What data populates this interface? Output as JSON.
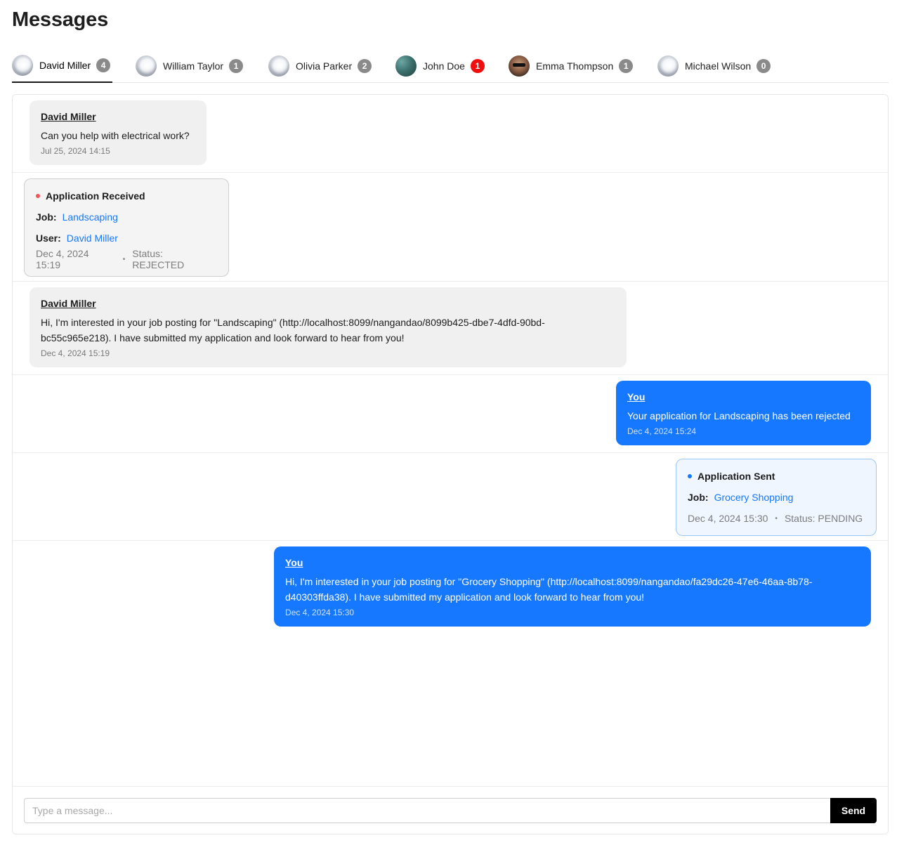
{
  "page": {
    "title": "Messages"
  },
  "tabs": [
    {
      "name": "David Miller",
      "badge": "4",
      "avatar": "default-avatar",
      "active": true
    },
    {
      "name": "William Taylor",
      "badge": "1",
      "avatar": "default-avatar"
    },
    {
      "name": "Olivia Parker",
      "badge": "2",
      "avatar": "default-avatar"
    },
    {
      "name": "John Doe",
      "badge": "1",
      "avatar": "marble-avatar",
      "badge_color": "#f00f0f"
    },
    {
      "name": "Emma Thompson",
      "badge": "1",
      "avatar": "photo-avatar"
    },
    {
      "name": "Michael Wilson",
      "badge": "0",
      "avatar": "default-avatar"
    }
  ],
  "messages": [
    {
      "sender": "David Miller",
      "text": "Can you help with electrical work?",
      "time": "Jul 25, 2024 14:15"
    },
    {
      "card": {
        "title": "Application Received",
        "job_label": "Job:",
        "job": "Landscaping",
        "user_label": "User:",
        "user": "David Miller",
        "time": "Dec 4, 2024 15:19",
        "status": "Status: REJECTED"
      }
    },
    {
      "sender": "David Miller",
      "text": "Hi, I'm interested in your job posting for \"Landscaping\" (http://localhost:8099/nangandao/8099b425-dbe7-4dfd-90bd-bc55c965e218). I have submitted my application and look forward to hear from you!",
      "time": "Dec 4, 2024 15:19"
    },
    {
      "sender": "You",
      "text": "Your application for Landscaping has been rejected",
      "time": "Dec 4, 2024 15:24"
    },
    {
      "card": {
        "title": "Application Sent",
        "job_label": "Job:",
        "job": "Grocery Shopping",
        "time": "Dec 4, 2024 15:30",
        "status": "Status: PENDING"
      }
    },
    {
      "sender": "You",
      "text": "Hi, I'm interested in your job posting for \"Grocery Shopping\" (http://localhost:8099/nangandao/fa29dc26-47e6-46aa-8b78-d40303ffda38). I have submitted my application and look forward to hear from you!",
      "time": "Dec 4, 2024 15:30"
    }
  ],
  "composer": {
    "placeholder": "Type a message...",
    "send_label": "Send"
  },
  "colors": {
    "accent": "#1677ff",
    "badge": "#8a8a8a",
    "badge_alert": "#f00f0f",
    "status_rejected_dot": "#f0545c"
  }
}
